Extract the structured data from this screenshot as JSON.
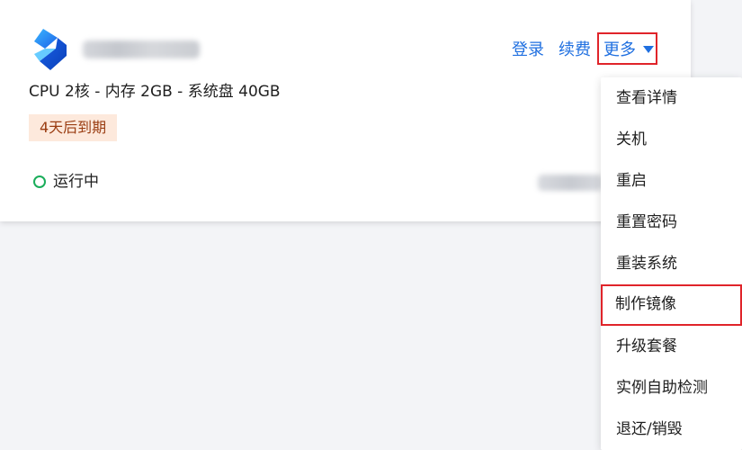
{
  "instance": {
    "spec": "CPU 2核 - 内存 2GB - 系统盘 40GB",
    "expire_badge": "4天后到期",
    "status": "运行中"
  },
  "actions": {
    "login": "登录",
    "renew": "续费",
    "more": "更多"
  },
  "menu": {
    "items": [
      {
        "label": "查看详情"
      },
      {
        "label": "关机"
      },
      {
        "label": "重启"
      },
      {
        "label": "重置密码"
      },
      {
        "label": "重装系统"
      },
      {
        "label": "制作镜像",
        "highlighted": true
      },
      {
        "label": "升级套餐"
      },
      {
        "label": "实例自助检测"
      },
      {
        "label": "退还/销毁"
      }
    ]
  },
  "colors": {
    "link": "#1f6fe0",
    "highlight_border": "#e0242a",
    "status_running": "#1aad5a",
    "badge_bg": "#fde9dc",
    "badge_text": "#9a3d12"
  },
  "icons": {
    "logo": "lighthouse-logo-icon",
    "status": "running-status-icon",
    "caret": "caret-down-icon"
  }
}
